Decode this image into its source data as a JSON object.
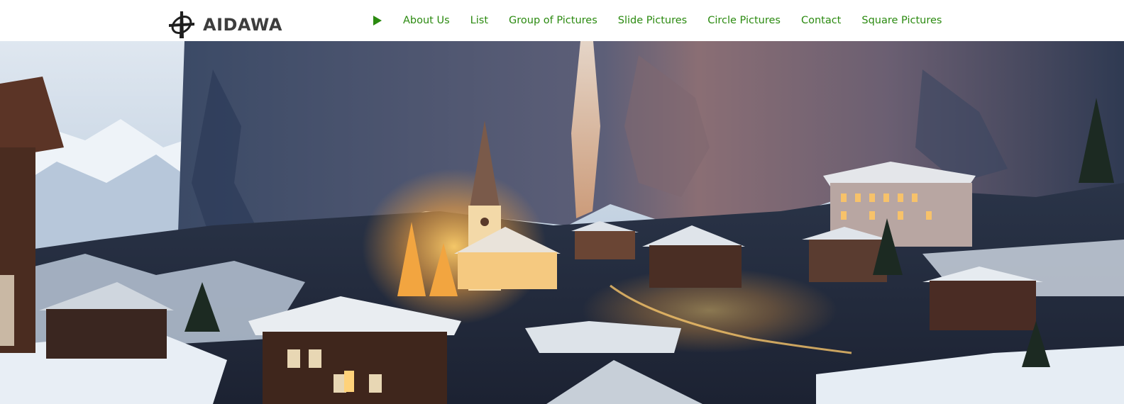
{
  "brand": {
    "name": "AIDAWA",
    "logo_icon": "cross-ring-logo-icon",
    "logo_color": "#3d3d3d"
  },
  "nav": {
    "play_icon": "play-icon",
    "link_color": "#2b8a10",
    "items": [
      {
        "label": "About Us"
      },
      {
        "label": "List"
      },
      {
        "label": "Group of Pictures"
      },
      {
        "label": "Slide Pictures"
      },
      {
        "label": "Circle Pictures"
      },
      {
        "label": "Contact"
      },
      {
        "label": "Square Pictures"
      }
    ]
  },
  "hero": {
    "image": "alpine-village-at-dusk-hero-image",
    "palette": {
      "sky": "#cfdbe8",
      "cliff": "#4a5a78",
      "glow": "#f0a040",
      "snow": "#e8eef5",
      "wood": "#4a2c20"
    }
  }
}
